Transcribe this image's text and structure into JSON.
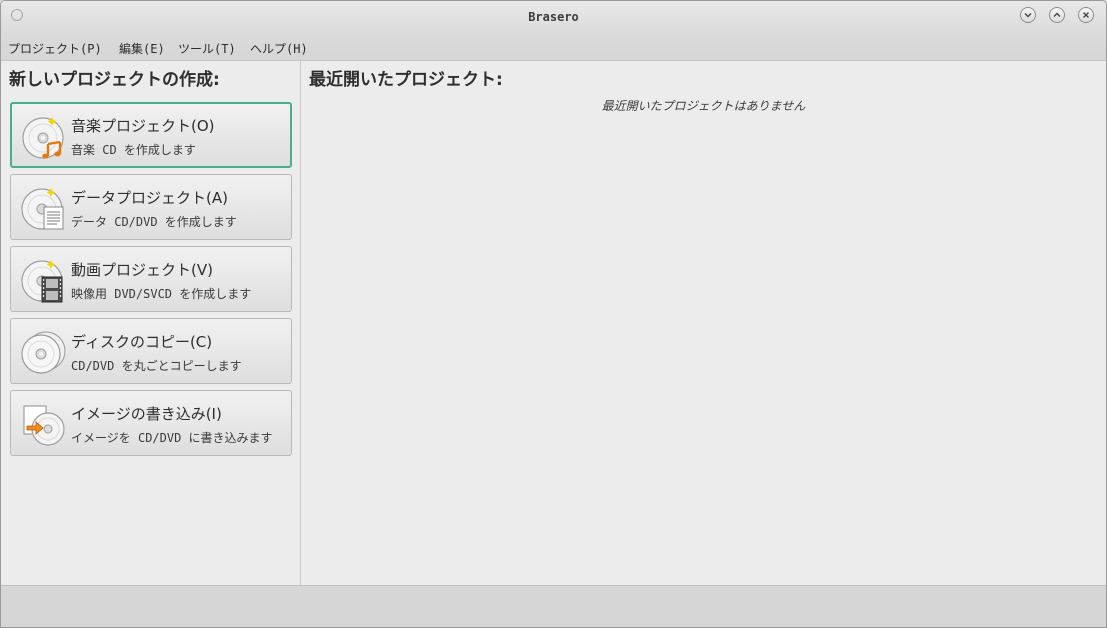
{
  "window": {
    "title": "Brasero"
  },
  "menubar": {
    "items": [
      "プロジェクト(P)",
      "編集(E)",
      "ツール(T)",
      "ヘルプ(H)"
    ]
  },
  "new_project": {
    "heading": "新しいプロジェクトの作成:",
    "buttons": [
      {
        "title": "音楽プロジェクト(O)",
        "desc": "音楽 CD を作成します",
        "icon": "audio-disc-icon",
        "focused": true
      },
      {
        "title": "データプロジェクト(A)",
        "desc": "データ CD/DVD を作成します",
        "icon": "data-disc-icon"
      },
      {
        "title": "動画プロジェクト(V)",
        "desc": "映像用 DVD/SVCD を作成します",
        "icon": "video-disc-icon"
      },
      {
        "title": "ディスクのコピー(C)",
        "desc": "CD/DVD を丸ごとコピーします",
        "icon": "disc-copy-icon"
      },
      {
        "title": "イメージの書き込み(I)",
        "desc": "イメージを CD/DVD に書き込みます",
        "icon": "image-burn-icon"
      }
    ]
  },
  "recent": {
    "heading": "最近開いたプロジェクト:",
    "empty_message": "最近開いたプロジェクトはありません"
  },
  "colors": {
    "focus_ring": "#4aae86",
    "window_bg": "#ececec"
  }
}
